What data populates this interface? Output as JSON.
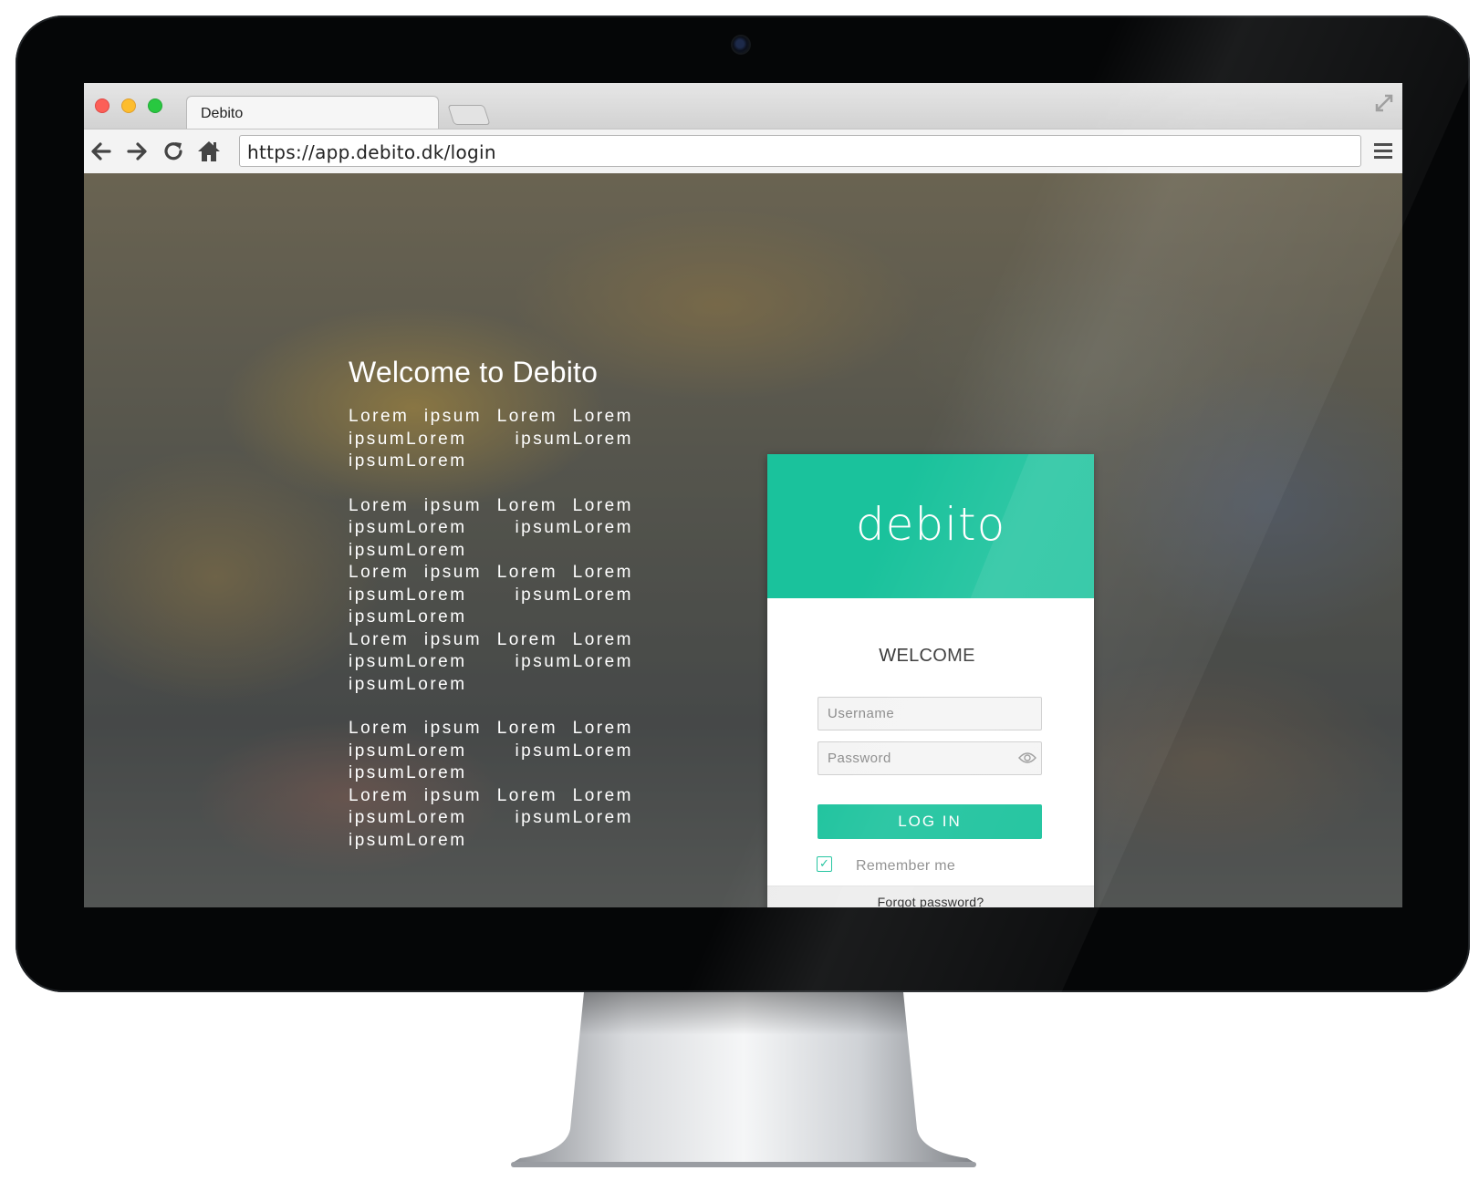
{
  "browser": {
    "tab_title": "Debito",
    "url": "https://app.debito.dk/login"
  },
  "hero": {
    "title": "Welcome to Debito",
    "paragraphs": [
      "Lorem ipsum Lorem Lorem ipsumLorem ipsumLorem ipsumLorem",
      "Lorem ipsum Lorem Lorem ipsumLorem ipsumLorem ipsumLorem",
      "Lorem ipsum Lorem Lorem ipsumLorem ipsumLorem ipsumLorem",
      "Lorem ipsum Lorem Lorem ipsumLorem ipsumLorem ipsumLorem",
      "Lorem ipsum Lorem Lorem ipsumLorem ipsumLorem ipsumLorem",
      "Lorem ipsum Lorem Lorem ipsumLorem ipsumLorem ipsumLorem"
    ]
  },
  "login": {
    "logo_text": "debito",
    "heading": "WELCOME",
    "username_placeholder": "Username",
    "password_placeholder": "Password",
    "submit_label": "LOG IN",
    "remember_label": "Remember me",
    "remember_checked": true,
    "forgot_label": "Forgot password?"
  },
  "colors": {
    "accent": "#1ac29c"
  },
  "icons": [
    "back-icon",
    "forward-icon",
    "reload-icon",
    "home-icon",
    "menu-icon",
    "fullscreen-icon",
    "eye-icon",
    "check-icon"
  ]
}
